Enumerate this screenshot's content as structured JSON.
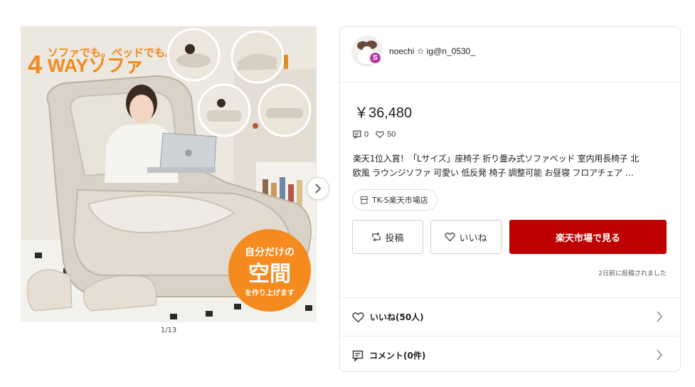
{
  "gallery": {
    "headline_top": "ソファでも。ベッドでも。",
    "headline_main_num": "4",
    "headline_main_word": "WAYソファ",
    "badge_line1": "自分だけの",
    "badge_line2": "空間",
    "badge_line3": "を作り上げます",
    "counter": "1/13",
    "next_icon": "chevron-right-icon"
  },
  "user": {
    "name": "noechi ☆ ig@n_0530_",
    "badge_letter": "S",
    "badge_color": "#b43aa8"
  },
  "product": {
    "price": "￥36,480",
    "comment_count": "0",
    "like_count": "50",
    "description_line1": "楽天1位入賞！「Lサイズ」座椅子 折り畳み式ソファベッド 室内用長椅子 北",
    "description_line2": "欧風 ラウンジソファ 可愛い 低反発 椅子 調整可能 お昼寝 フロアチェア …",
    "shop_name": "TK-S楽天市場店"
  },
  "actions": {
    "post_label": "投稿",
    "like_label": "いいね",
    "rakuten_label": "楽天市場で見る",
    "rakuten_color": "#bf0000"
  },
  "posted_text": "2日前に投稿されました",
  "rows": {
    "likes_label": "いいね(50人)",
    "comments_label": "コメント(0件)"
  }
}
